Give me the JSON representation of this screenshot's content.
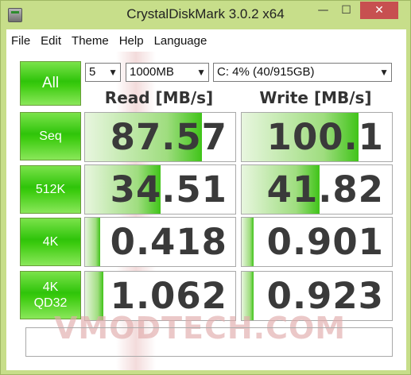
{
  "window": {
    "title": "CrystalDiskMark 3.0.2 x64",
    "controls": {
      "minimize": "—",
      "maximize": "☐",
      "close": "✕"
    }
  },
  "menu": [
    "File",
    "Edit",
    "Theme",
    "Help",
    "Language"
  ],
  "controls": {
    "all_label": "All",
    "count": "5",
    "size": "1000MB",
    "drive": "C: 4% (40/915GB)"
  },
  "headers": {
    "read": "Read [MB/s]",
    "write": "Write [MB/s]"
  },
  "tests": [
    {
      "label": "Seq",
      "read": "87.57",
      "write": "100.1",
      "read_level": 0.78,
      "write_level": 0.78
    },
    {
      "label": "512K",
      "read": "34.51",
      "write": "41.82",
      "read_level": 0.5,
      "write_level": 0.52
    },
    {
      "label": "4K",
      "read": "0.418",
      "write": "0.901",
      "read_level": 0.1,
      "write_level": 0.08
    },
    {
      "label": "4K\nQD32",
      "read": "1.062",
      "write": "0.923",
      "read_level": 0.12,
      "write_level": 0.08
    }
  ],
  "watermark": "VMODTECH.COM",
  "comment": "",
  "colors": {
    "frame": "#c7de8a",
    "button_green": "#2fc40a",
    "bar_green": "#40c419",
    "value_text": "#3a3a3a"
  }
}
